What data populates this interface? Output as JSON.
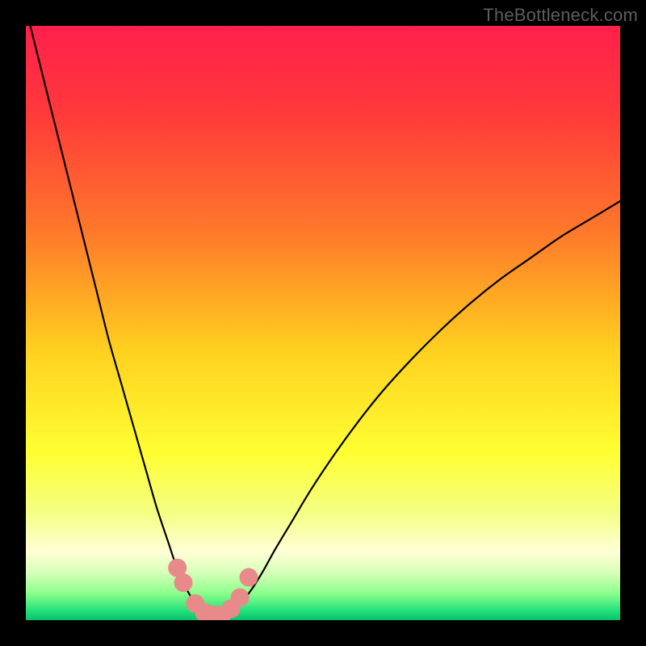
{
  "watermark": "TheBottleneck.com",
  "chart_data": {
    "type": "line",
    "title": "",
    "xlabel": "",
    "ylabel": "",
    "xlim": [
      0,
      100
    ],
    "ylim": [
      0,
      100
    ],
    "series": [
      {
        "name": "bottleneck-curve",
        "x": [
          0,
          2,
          4,
          6,
          8,
          10,
          12,
          14,
          16,
          18,
          20,
          22,
          24,
          25,
          26,
          27,
          28,
          29,
          30,
          31,
          32,
          33,
          34,
          35,
          36,
          38,
          40,
          42,
          45,
          48,
          52,
          56,
          60,
          65,
          70,
          75,
          80,
          85,
          90,
          95,
          100
        ],
        "values": [
          103,
          95,
          87,
          79,
          71,
          63,
          55,
          47,
          40,
          33,
          26,
          19,
          13,
          10,
          7.5,
          5.3,
          3.6,
          2.3,
          1.4,
          0.9,
          0.65,
          0.65,
          0.95,
          1.6,
          2.6,
          5.2,
          8.4,
          12,
          17,
          22,
          28,
          33.5,
          38.5,
          44,
          49,
          53.5,
          57.5,
          61,
          64.5,
          67.5,
          70.5
        ]
      }
    ],
    "markers": {
      "name": "highlight-points",
      "x": [
        25.5,
        26.5,
        28.5,
        30,
        31.5,
        33,
        34.5,
        36,
        37.5
      ],
      "values": [
        8.8,
        6.3,
        2.8,
        1.3,
        0.9,
        0.9,
        1.9,
        3.8,
        7.2
      ]
    },
    "gradient_stops": [
      {
        "offset": 0,
        "color": "#ff1f4b"
      },
      {
        "offset": 0.15,
        "color": "#ff3a3a"
      },
      {
        "offset": 0.35,
        "color": "#ff7a2a"
      },
      {
        "offset": 0.55,
        "color": "#ffd21f"
      },
      {
        "offset": 0.72,
        "color": "#ffff33"
      },
      {
        "offset": 0.82,
        "color": "#f4ff84"
      },
      {
        "offset": 0.885,
        "color": "#ffffd6"
      },
      {
        "offset": 0.92,
        "color": "#d6ffb8"
      },
      {
        "offset": 0.955,
        "color": "#8cff8c"
      },
      {
        "offset": 0.985,
        "color": "#1fe07a"
      },
      {
        "offset": 1.0,
        "color": "#0fbf6a"
      }
    ]
  }
}
